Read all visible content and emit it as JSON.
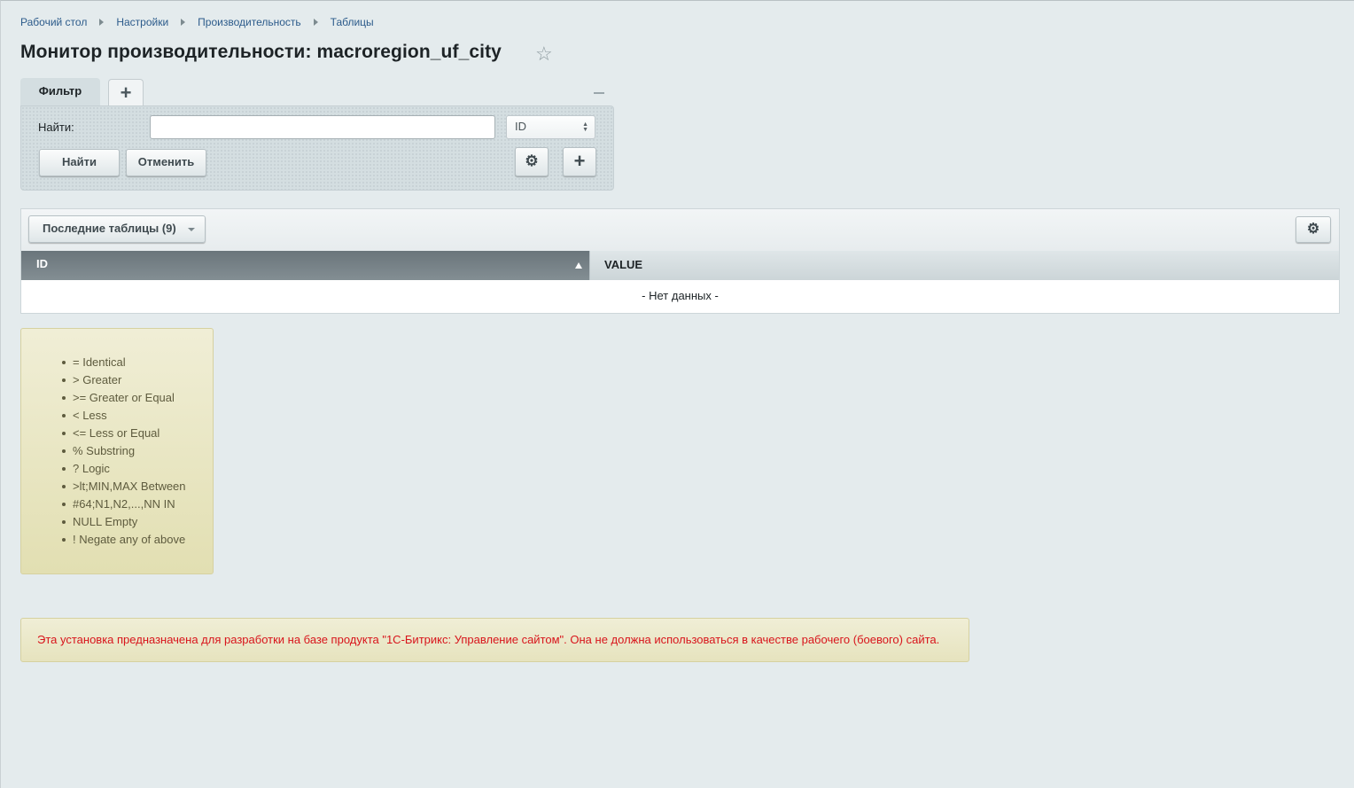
{
  "breadcrumb": {
    "items": [
      "Рабочий стол",
      "Настройки",
      "Производительность",
      "Таблицы"
    ]
  },
  "page": {
    "title": "Монитор производительности: macroregion_uf_city"
  },
  "filter": {
    "tab_label": "Фильтр",
    "find_label": "Найти:",
    "find_value": "",
    "field_select_value": "ID",
    "find_button": "Найти",
    "cancel_button": "Отменить"
  },
  "grid": {
    "recent_tables_label": "Последние таблицы (9)",
    "columns": [
      "ID",
      "VALUE"
    ],
    "sort_column": "ID",
    "sort_direction": "asc",
    "empty_message": "- Нет данных -"
  },
  "hints": {
    "items": [
      "= Identical",
      "> Greater",
      ">= Greater or Equal",
      "< Less",
      "<= Less or Equal",
      "% Substring",
      "? Logic",
      ">lt;MIN,MAX Between",
      "#64;N1,N2,...,NN IN",
      "NULL Empty",
      "! Negate any of above"
    ]
  },
  "warning": {
    "text": "Эта установка предназначена для разработки на базе продукта \"1С-Битрикс: Управление сайтом\". Она не должна использоваться в качестве рабочего (боевого) сайта."
  },
  "colors": {
    "background": "#e4ebed",
    "link": "#2c5b8b",
    "warning_text": "#d8141b",
    "header_dark": "#6a757b"
  },
  "icons": {
    "favorite": "star-icon",
    "settings": "gear-icon",
    "add": "plus-icon",
    "collapse": "minus-icon",
    "sort": "sort-asc-icon"
  }
}
